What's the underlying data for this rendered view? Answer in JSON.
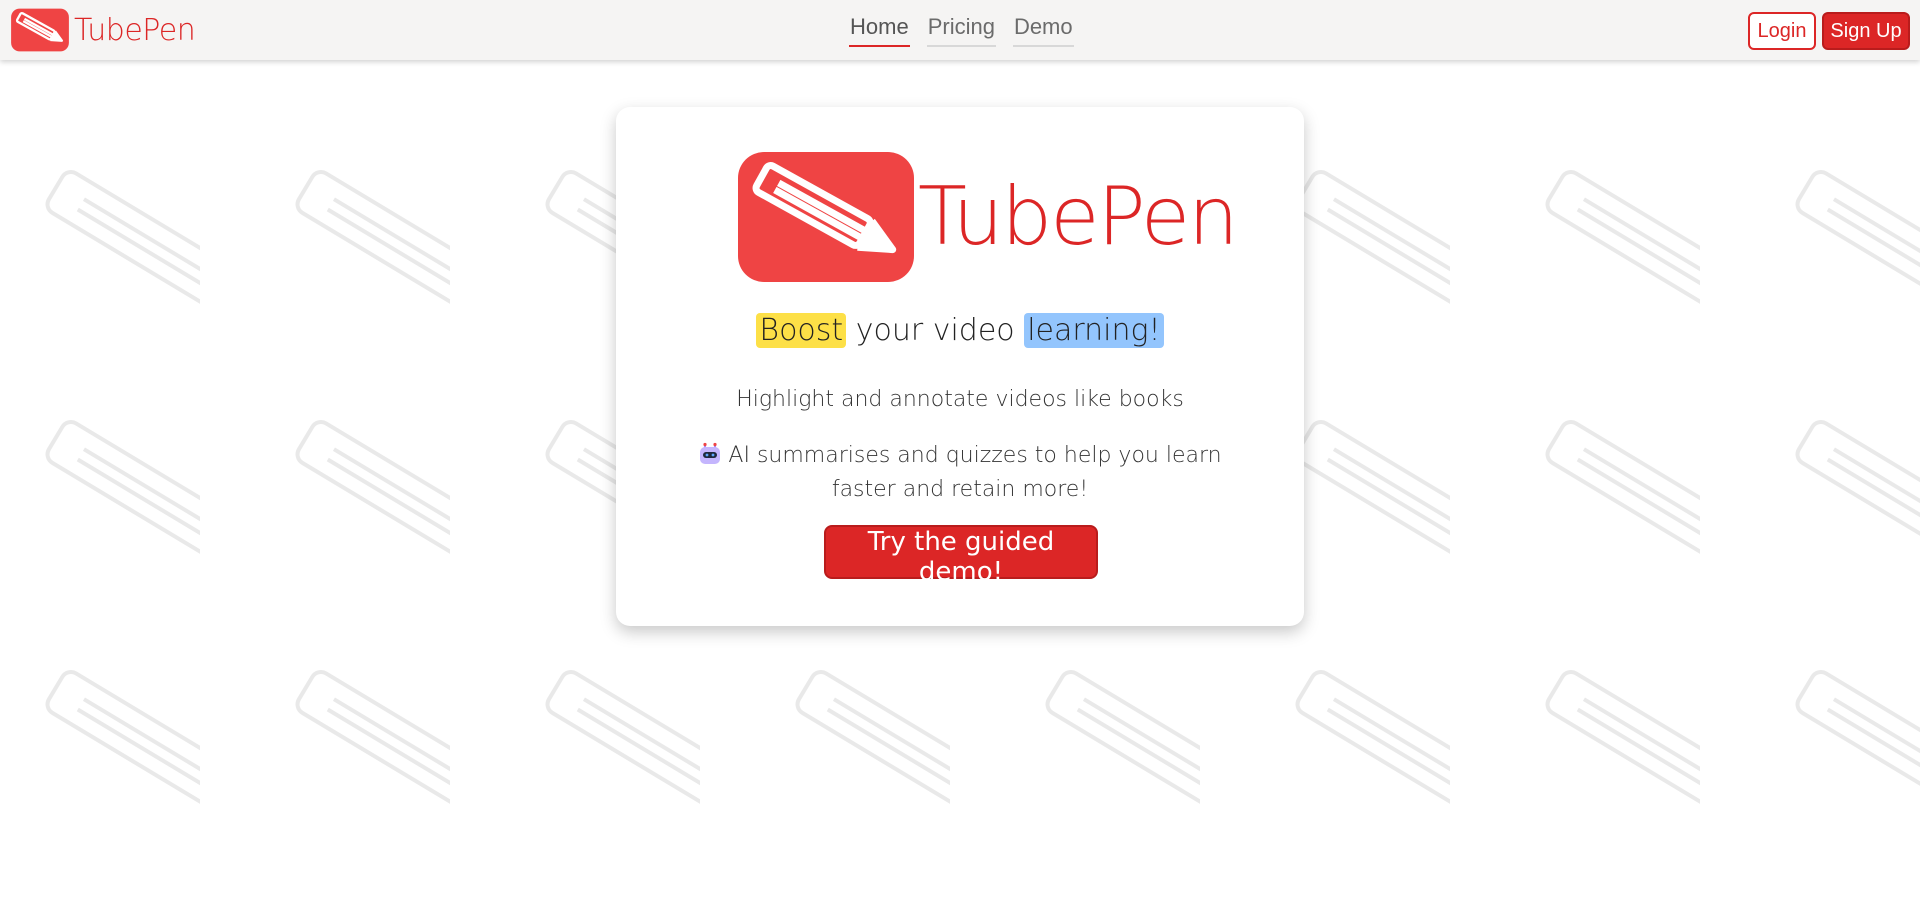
{
  "navbar": {
    "brand_name": "TubePen",
    "links": [
      {
        "label": "Home",
        "active": true
      },
      {
        "label": "Pricing",
        "active": false
      },
      {
        "label": "Demo",
        "active": false
      }
    ],
    "login_label": "Login",
    "signup_label": "Sign Up"
  },
  "hero": {
    "brand_name": "TubePen",
    "tagline_highlight_1": "Boost",
    "tagline_middle": " your video ",
    "tagline_highlight_2": "learning!",
    "subline": "Highlight and annotate videos like books",
    "ai_text": "AI summarises and quizzes to help you learn faster and retain more!",
    "cta_label": "Try the guided demo!"
  },
  "icons": {
    "brand": "pencil-logo-icon",
    "ai": "robot-icon"
  },
  "colors": {
    "brand_red": "#dc2626",
    "logo_red": "#ef4444",
    "highlight_yellow": "#fde047",
    "highlight_blue": "#93c5fd",
    "navbar_bg": "#f5f4f3"
  }
}
